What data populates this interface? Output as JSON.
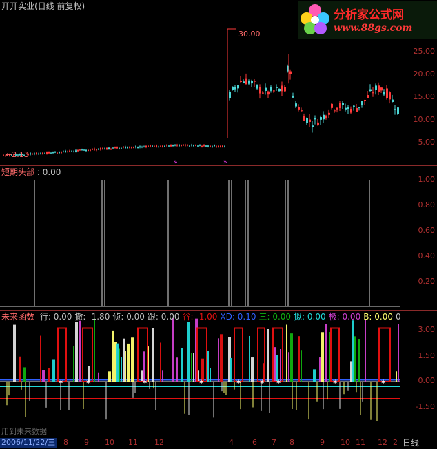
{
  "colors": {
    "background": "#000000",
    "axis": "#b03030",
    "candle_up": "#ff3a3a",
    "candle_down": "#4cd6d6",
    "white_line": "#e0e0e0",
    "yellow": "#ffff70",
    "red": "#e01010",
    "green": "#10b010",
    "cyan": "#20d8d8",
    "blue": "#3060ff"
  },
  "logo": {
    "text": "分析家公式网",
    "url": "www.88gs.com"
  },
  "price_panel": {
    "title": "开开实业(日线 前复权)",
    "high_label": "30.00",
    "low_label": "2.13",
    "ticks": [
      "25.00",
      "20.00",
      "15.00",
      "10.00",
      "5.00"
    ]
  },
  "short_top_panel": {
    "title": "短期头部",
    "value": "0.00",
    "ticks": [
      "1.00",
      "0.80",
      "0.60",
      "0.40",
      "0.20"
    ]
  },
  "future_panel": {
    "title": "未来函数",
    "items": [
      {
        "label": "行:",
        "value": "0.00",
        "color": "#c0c0c0"
      },
      {
        "label": "撤:",
        "value": "-1.80",
        "color": "#c0c0c0"
      },
      {
        "label": "侦:",
        "value": "0.00",
        "color": "#c0c0c0"
      },
      {
        "label": "跟:",
        "value": "0.00",
        "color": "#c0c0c0"
      },
      {
        "label": "谷:",
        "value": "-1.00",
        "color": "#e01010"
      },
      {
        "label": "XD:",
        "value": "0.10",
        "color": "#3060ff"
      },
      {
        "label": "三:",
        "value": "0.00",
        "color": "#10b010"
      },
      {
        "label": "拟:",
        "value": "0.00",
        "color": "#20d8d8"
      },
      {
        "label": "极:",
        "value": "0.00",
        "color": "#d040d0"
      },
      {
        "label": "B:",
        "value": "0.00",
        "color": "#ffff70"
      },
      {
        "label": "0",
        "value": "",
        "color": "#c0c0c0"
      }
    ],
    "ticks": [
      "3.00",
      "1.50",
      "0.00",
      "-1.50"
    ],
    "hint": "用到未来数据"
  },
  "bottom_bar": {
    "date": "2006/11/22/三",
    "months": [
      "8",
      "9",
      "10",
      "11",
      "12",
      "4",
      "6",
      "7",
      "8",
      "9",
      "10",
      "11",
      "12",
      "2"
    ],
    "period": "日线"
  }
}
